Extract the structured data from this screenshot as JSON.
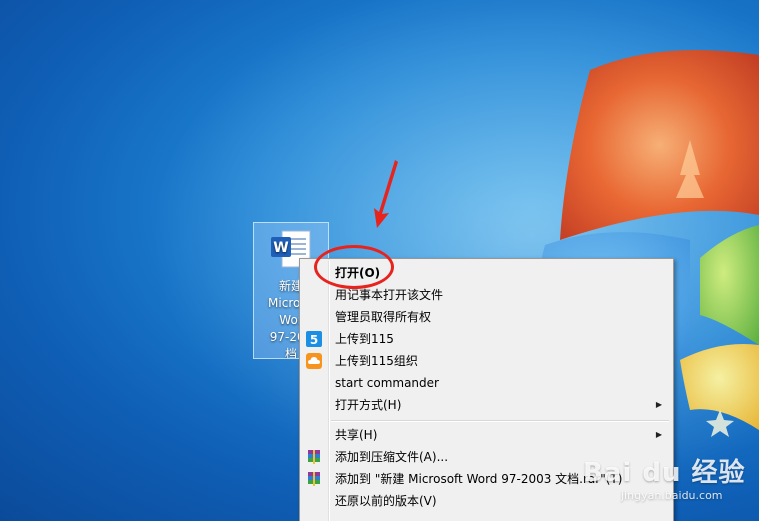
{
  "desktop": {
    "icon": {
      "label": "新建\nMicroso\nWor\n97-200\n档",
      "glyph": "W"
    }
  },
  "context_menu": {
    "items": [
      {
        "label": "打开(O)",
        "bold": true,
        "icon": "",
        "submenu": false
      },
      {
        "label": "用记事本打开该文件",
        "icon": "",
        "submenu": false
      },
      {
        "label": "管理员取得所有权",
        "icon": "",
        "submenu": false
      },
      {
        "label": "上传到115",
        "icon": "115-icon",
        "submenu": false
      },
      {
        "label": "上传到115组织",
        "icon": "115-org-icon",
        "submenu": false
      },
      {
        "label": "start commander",
        "icon": "",
        "submenu": false
      },
      {
        "label": "打开方式(H)",
        "icon": "",
        "submenu": true
      },
      {
        "label": "共享(H)",
        "icon": "",
        "submenu": true
      },
      {
        "label": "添加到压缩文件(A)...",
        "icon": "winrar-icon",
        "submenu": false
      },
      {
        "label": "添加到 \"新建 Microsoft Word 97-2003 文档.rar\"(T)",
        "icon": "winrar-icon",
        "submenu": false
      },
      {
        "label": "还原以前的版本(V)",
        "icon": "",
        "submenu": false
      }
    ],
    "submenu_glyph": "▶"
  },
  "watermark": {
    "brand": "Bai du 经验",
    "url": "jingyan.baidu.com"
  },
  "colors": {
    "annotation_red": "#e8231d",
    "menu_bg": "#f0f0f0"
  }
}
